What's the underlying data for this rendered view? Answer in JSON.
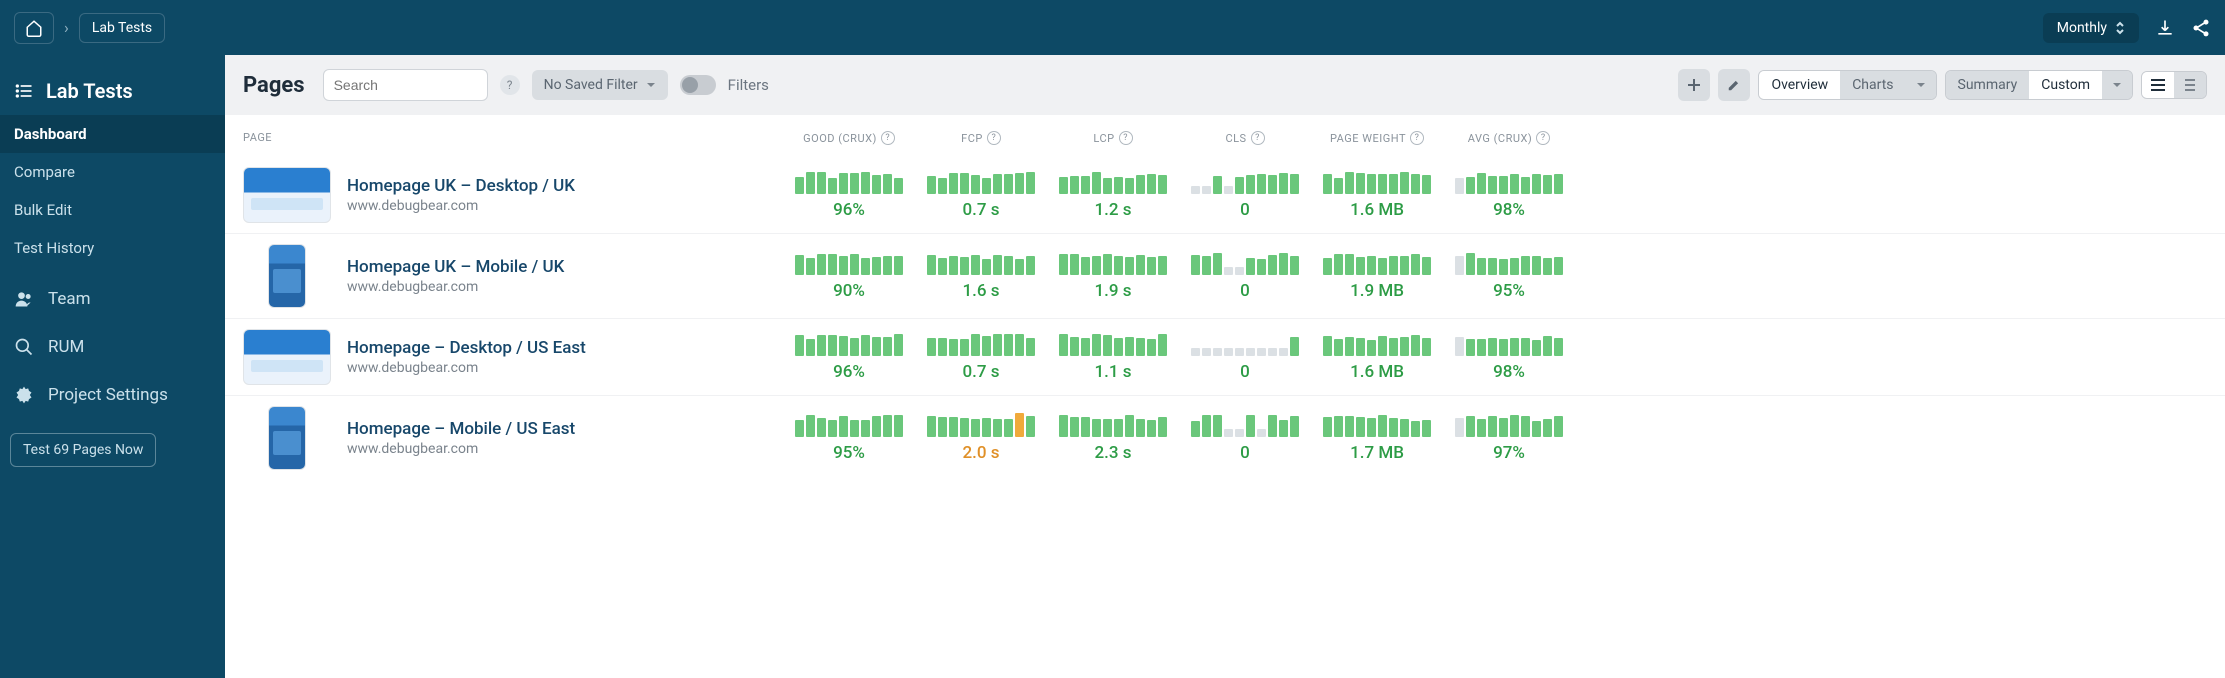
{
  "breadcrumb": {
    "current": "Lab Tests"
  },
  "period_selector": "Monthly",
  "sidebar": {
    "title": "Lab Tests",
    "items": [
      {
        "label": "Dashboard"
      },
      {
        "label": "Compare"
      },
      {
        "label": "Bulk Edit"
      },
      {
        "label": "Test History"
      }
    ],
    "icon_items": [
      {
        "label": "Team"
      },
      {
        "label": "RUM"
      },
      {
        "label": "Project Settings"
      }
    ],
    "test_now": "Test 69 Pages Now"
  },
  "toolbar": {
    "title": "Pages",
    "search_placeholder": "Search",
    "filter_dd": "No Saved Filter",
    "filters_label": "Filters",
    "view_overview": "Overview",
    "view_charts": "Charts",
    "mode_summary": "Summary",
    "mode_custom": "Custom"
  },
  "columns": {
    "page": "PAGE",
    "good": "GOOD (CRUX)",
    "fcp": "FCP",
    "lcp": "LCP",
    "cls": "CLS",
    "weight": "PAGE WEIGHT",
    "avg": "AVG (CRUX)"
  },
  "rows": [
    {
      "name": "Homepage UK – Desktop / UK",
      "url": "www.debugbear.com",
      "thumb": "desktop",
      "metrics": {
        "good": {
          "val": "96%",
          "status": "green"
        },
        "fcp": {
          "val": "0.7 s",
          "status": "green"
        },
        "lcp": {
          "val": "1.2 s",
          "status": "green"
        },
        "cls": {
          "val": "0",
          "status": "green"
        },
        "weight": {
          "val": "1.6 MB",
          "status": "green"
        },
        "avg": {
          "val": "98%",
          "status": "green"
        }
      }
    },
    {
      "name": "Homepage UK – Mobile / UK",
      "url": "www.debugbear.com",
      "thumb": "mobile",
      "metrics": {
        "good": {
          "val": "90%",
          "status": "green"
        },
        "fcp": {
          "val": "1.6 s",
          "status": "green"
        },
        "lcp": {
          "val": "1.9 s",
          "status": "green"
        },
        "cls": {
          "val": "0",
          "status": "green"
        },
        "weight": {
          "val": "1.9 MB",
          "status": "green"
        },
        "avg": {
          "val": "95%",
          "status": "green"
        }
      }
    },
    {
      "name": "Homepage – Desktop / US East",
      "url": "www.debugbear.com",
      "thumb": "desktop",
      "metrics": {
        "good": {
          "val": "96%",
          "status": "green"
        },
        "fcp": {
          "val": "0.7 s",
          "status": "green"
        },
        "lcp": {
          "val": "1.1 s",
          "status": "green"
        },
        "cls": {
          "val": "0",
          "status": "green"
        },
        "weight": {
          "val": "1.6 MB",
          "status": "green"
        },
        "avg": {
          "val": "98%",
          "status": "green"
        }
      }
    },
    {
      "name": "Homepage – Mobile / US East",
      "url": "www.debugbear.com",
      "thumb": "mobile",
      "metrics": {
        "good": {
          "val": "95%",
          "status": "green"
        },
        "fcp": {
          "val": "2.0 s",
          "status": "orange"
        },
        "lcp": {
          "val": "2.3 s",
          "status": "green"
        },
        "cls": {
          "val": "0",
          "status": "green"
        },
        "weight": {
          "val": "1.7 MB",
          "status": "green"
        },
        "avg": {
          "val": "97%",
          "status": "green"
        }
      }
    }
  ],
  "chart_data": {
    "type": "table",
    "columns": [
      "Page",
      "Good (CrUX)",
      "FCP",
      "LCP",
      "CLS",
      "Page Weight",
      "Avg (CrUX)"
    ],
    "rows": [
      [
        "Homepage UK – Desktop / UK",
        "96%",
        "0.7 s",
        "1.2 s",
        "0",
        "1.6 MB",
        "98%"
      ],
      [
        "Homepage UK – Mobile / UK",
        "90%",
        "1.6 s",
        "1.9 s",
        "0",
        "1.9 MB",
        "95%"
      ],
      [
        "Homepage – Desktop / US East",
        "96%",
        "0.7 s",
        "1.1 s",
        "0",
        "1.6 MB",
        "98%"
      ],
      [
        "Homepage – Mobile / US East",
        "95%",
        "2.0 s",
        "2.3 s",
        "0",
        "1.7 MB",
        "97%"
      ]
    ]
  },
  "sparklines": {
    "default": [
      1,
      1,
      1,
      1,
      1,
      1,
      1,
      1,
      1,
      1
    ],
    "cls_row1": [
      0.2,
      0.2,
      1,
      0.2,
      1,
      1,
      1,
      1,
      1,
      1
    ],
    "cls_row2": [
      1,
      1,
      1,
      0.2,
      0.2,
      1,
      1,
      1,
      1,
      1
    ],
    "cls_row3": [
      0.2,
      0.2,
      0.2,
      0.2,
      0.2,
      0.2,
      0.2,
      0.2,
      0.2,
      1
    ],
    "cls_row4": [
      1,
      1,
      1,
      0.2,
      0.2,
      1,
      0.2,
      1,
      1,
      1
    ],
    "fcp_row4": [
      1,
      1,
      1,
      1,
      1,
      1,
      1,
      1,
      2,
      1
    ],
    "avg_prefix_gray": 1
  }
}
